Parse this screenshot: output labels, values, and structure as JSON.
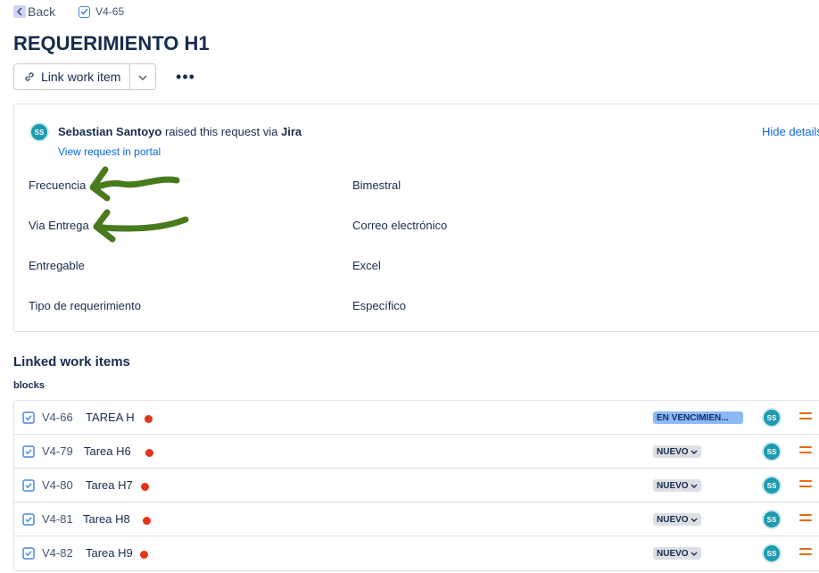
{
  "header": {
    "back_label": "Back",
    "issue_key": "V4-65",
    "title": "REQUERIMIENTO H1",
    "link_button_label": "Link work item",
    "more_label": "•••"
  },
  "request": {
    "avatar_initials": "SS",
    "reporter": "Sebastian Santoyo",
    "raised_text": "raised this request via",
    "channel": "Jira",
    "portal_link": "View request in portal",
    "hide_details": "Hide details",
    "fields": [
      {
        "label": "Frecuencia",
        "value": "Bimestral"
      },
      {
        "label": "Via Entrega",
        "value": "Correo electrónico"
      },
      {
        "label": "Entregable",
        "value": "Excel"
      },
      {
        "label": "Tipo de requerimiento",
        "value": "Específico"
      }
    ]
  },
  "linked": {
    "title": "Linked work items",
    "relation": "blocks",
    "items": [
      {
        "key": "V4-66",
        "summary": "TAREA H",
        "status": "EN VENCIMIEN...",
        "assignee": "SS"
      },
      {
        "key": "V4-79",
        "summary": "Tarea H6",
        "status": "NUEVO",
        "assignee": "SS"
      },
      {
        "key": "V4-80",
        "summary": "Tarea H7",
        "status": "NUEVO",
        "assignee": "SS"
      },
      {
        "key": "V4-81",
        "summary": "Tarea H8",
        "status": "NUEVO",
        "assignee": "SS"
      },
      {
        "key": "V4-82",
        "summary": "Tarea H9",
        "status": "NUEVO",
        "assignee": "SS"
      }
    ]
  },
  "colors": {
    "link": "#0c66e4",
    "avatar": "#1d9bb0",
    "priority_dot": "#e5341b",
    "priority_icon": "#e56910",
    "status_in_progress": "#8fb8f6",
    "status_new": "#dcdfe4",
    "annotation_arrow": "#4a7a1e"
  },
  "icons": {
    "back": "chevron-left-icon",
    "issue_type": "checkbox-task-icon",
    "link": "link-chain-icon",
    "dropdown": "chevron-down-icon",
    "priority": "priority-medium-icon"
  }
}
